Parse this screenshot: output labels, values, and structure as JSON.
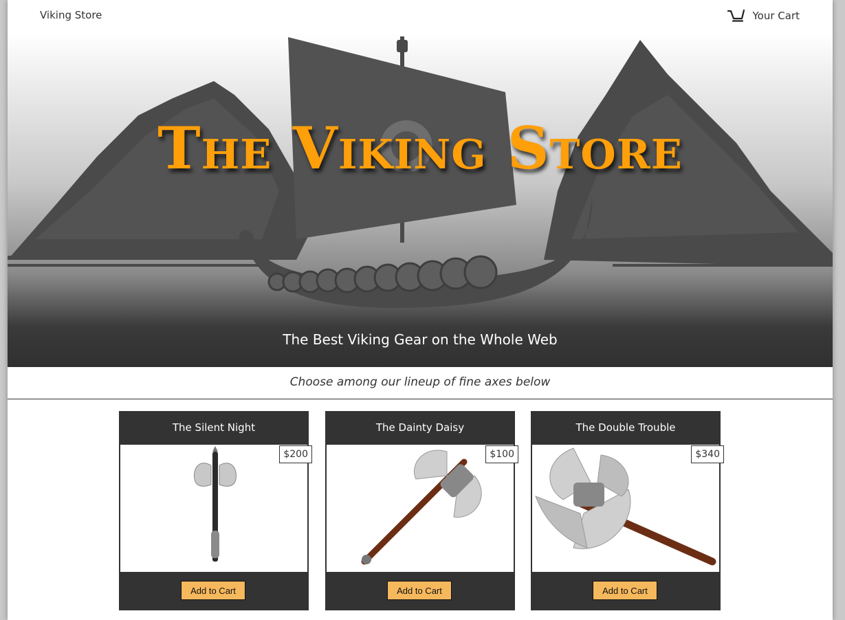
{
  "nav": {
    "brand": "Viking Store",
    "cart_label": "Your Cart"
  },
  "hero": {
    "title": "The Viking Store",
    "subtitle": "The Best Viking Gear on the Whole Web"
  },
  "tagline": "Choose among our lineup of fine axes below",
  "products": [
    {
      "name": "The Silent Night",
      "price": "$200",
      "button": "Add to Cart"
    },
    {
      "name": "The Dainty Daisy",
      "price": "$100",
      "button": "Add to Cart"
    },
    {
      "name": "The Double Trouble",
      "price": "$340",
      "button": "Add to Cart"
    }
  ],
  "colors": {
    "accent": "#ff9f0a",
    "dark": "#333333",
    "button": "#f6b85d"
  },
  "icons": [
    "cart-icon",
    "viking-ship-illustration",
    "double-axe-image"
  ]
}
